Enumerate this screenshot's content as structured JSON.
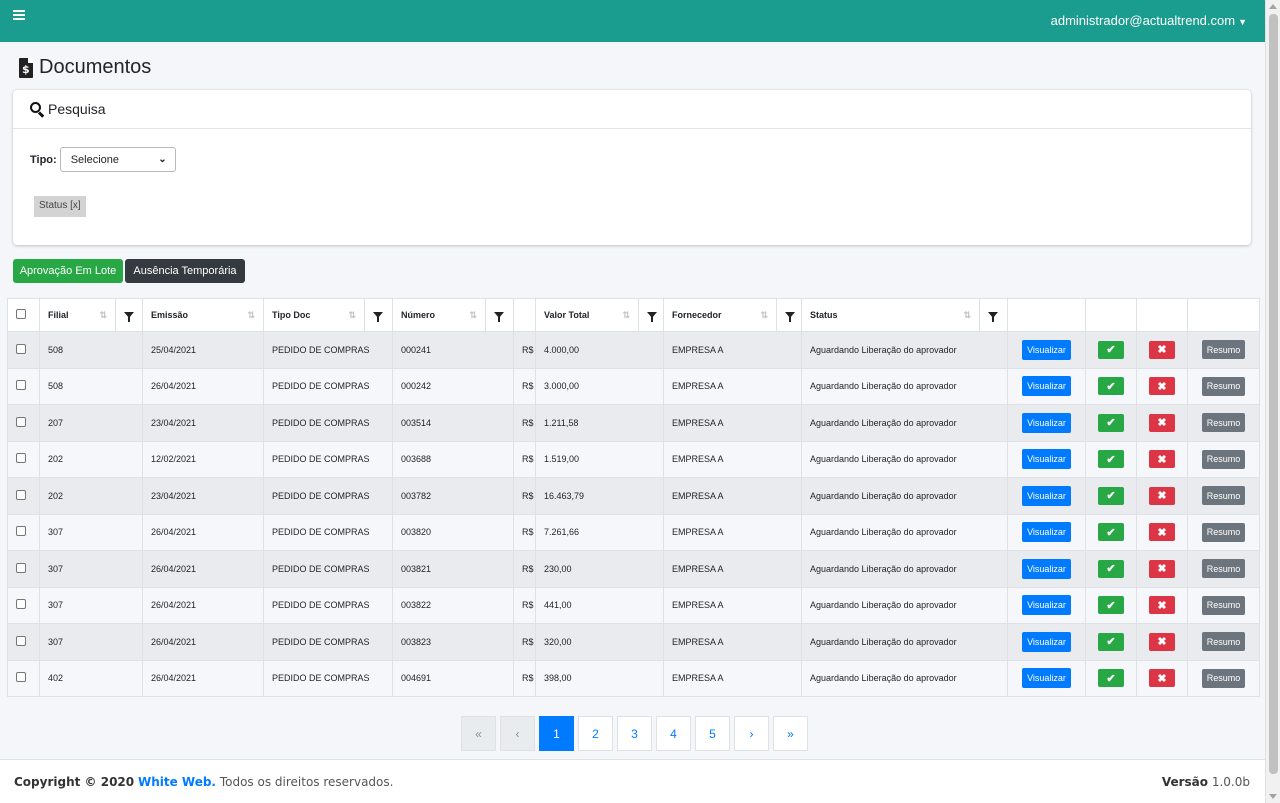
{
  "topbar": {
    "user_email": "administrador@actualtrend.com"
  },
  "page": {
    "title": "Documentos"
  },
  "search": {
    "title": "Pesquisa",
    "tipo_label": "Tipo:",
    "tipo_value": "Selecione",
    "status_chip": "Status [x]"
  },
  "actions": {
    "lote_label": "Aprovação Em Lote",
    "ausencia_label": "Ausência Temporária"
  },
  "table": {
    "headers": {
      "filial": "Filial",
      "emissao": "Emissão",
      "tipo_doc": "Tipo Doc",
      "numero": "Número",
      "valor_total": "Valor Total",
      "fornecedor": "Fornecedor",
      "status": "Status"
    },
    "button_labels": {
      "visualizar": "Visualizar",
      "approve": "✔",
      "reject": "✖",
      "resumo": "Resumo"
    },
    "currency": "R$",
    "rows": [
      {
        "filial": "508",
        "emissao": "25/04/2021",
        "tipo_doc": "PEDIDO DE COMPRAS",
        "numero": "000241",
        "valor": "4.000,00",
        "fornecedor": "EMPRESA A",
        "status": "Aguardando Liberação do aprovador"
      },
      {
        "filial": "508",
        "emissao": "26/04/2021",
        "tipo_doc": "PEDIDO DE COMPRAS",
        "numero": "000242",
        "valor": "3.000,00",
        "fornecedor": "EMPRESA A",
        "status": "Aguardando Liberação do aprovador"
      },
      {
        "filial": "207",
        "emissao": "23/04/2021",
        "tipo_doc": "PEDIDO DE COMPRAS",
        "numero": "003514",
        "valor": "1.211,58",
        "fornecedor": "EMPRESA A",
        "status": "Aguardando Liberação do aprovador"
      },
      {
        "filial": "202",
        "emissao": "12/02/2021",
        "tipo_doc": "PEDIDO DE COMPRAS",
        "numero": "003688",
        "valor": "1.519,00",
        "fornecedor": "EMPRESA A",
        "status": "Aguardando Liberação do aprovador"
      },
      {
        "filial": "202",
        "emissao": "23/04/2021",
        "tipo_doc": "PEDIDO DE COMPRAS",
        "numero": "003782",
        "valor": "16.463,79",
        "fornecedor": "EMPRESA A",
        "status": "Aguardando Liberação do aprovador"
      },
      {
        "filial": "307",
        "emissao": "26/04/2021",
        "tipo_doc": "PEDIDO DE COMPRAS",
        "numero": "003820",
        "valor": "7.261,66",
        "fornecedor": "EMPRESA A",
        "status": "Aguardando Liberação do aprovador"
      },
      {
        "filial": "307",
        "emissao": "26/04/2021",
        "tipo_doc": "PEDIDO DE COMPRAS",
        "numero": "003821",
        "valor": "230,00",
        "fornecedor": "EMPRESA A",
        "status": "Aguardando Liberação do aprovador"
      },
      {
        "filial": "307",
        "emissao": "26/04/2021",
        "tipo_doc": "PEDIDO DE COMPRAS",
        "numero": "003822",
        "valor": "441,00",
        "fornecedor": "EMPRESA A",
        "status": "Aguardando Liberação do aprovador"
      },
      {
        "filial": "307",
        "emissao": "26/04/2021",
        "tipo_doc": "PEDIDO DE COMPRAS",
        "numero": "003823",
        "valor": "320,00",
        "fornecedor": "EMPRESA A",
        "status": "Aguardando Liberação do aprovador"
      },
      {
        "filial": "402",
        "emissao": "26/04/2021",
        "tipo_doc": "PEDIDO DE COMPRAS",
        "numero": "004691",
        "valor": "398,00",
        "fornecedor": "EMPRESA A",
        "status": "Aguardando Liberação do aprovador"
      }
    ]
  },
  "pagination": {
    "first": "«",
    "prev": "‹",
    "pages": [
      "1",
      "2",
      "3",
      "4",
      "5"
    ],
    "active_page": "1",
    "next": "›",
    "last": "»"
  },
  "footer": {
    "copyright": "Copyright © 2020",
    "brand": "White Web.",
    "rights": "Todos os direitos reservados.",
    "version_label": "Versão",
    "version_value": "1.0.0b"
  },
  "colors": {
    "topbar": "#1a9c8f",
    "primary": "#007bff",
    "success": "#28a745",
    "danger": "#dc3545",
    "secondary": "#6c757d",
    "dark": "#343a40"
  }
}
